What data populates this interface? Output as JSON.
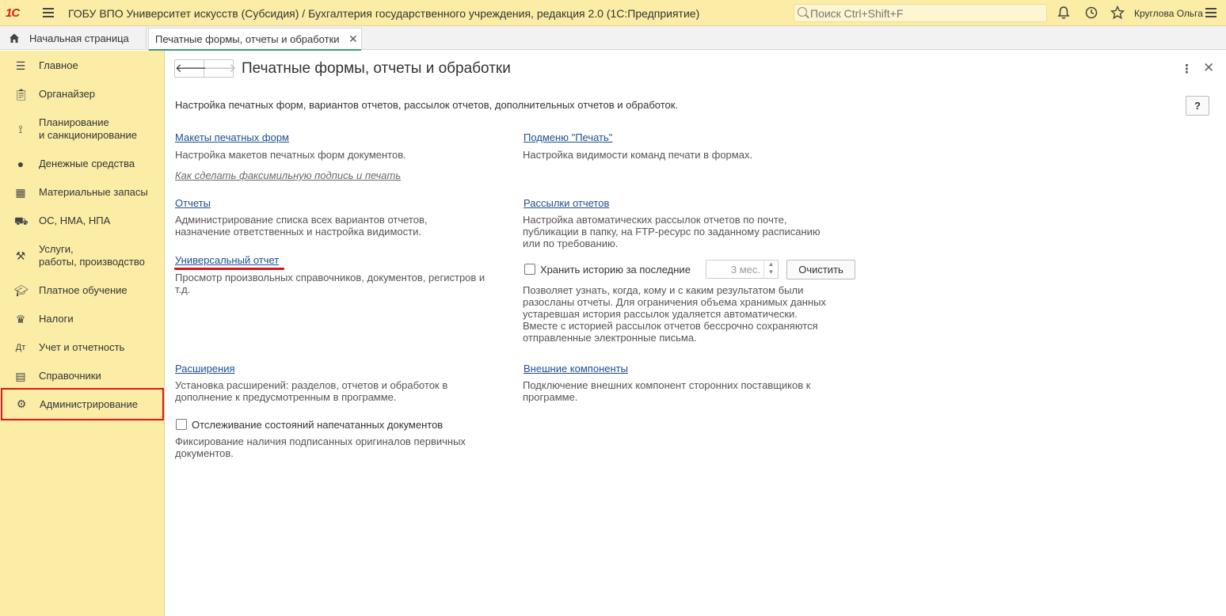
{
  "titlebar": {
    "logo": "1С",
    "title": "ГОБУ ВПО Университет искусств (Субсидия) / Бухгалтерия государственного учреждения, редакция 2.0  (1С:Предприятие)",
    "search_placeholder": "Поиск Ctrl+Shift+F",
    "user": "Круглова Ольга"
  },
  "tabs": {
    "home": "Начальная страница",
    "active": "Печатные формы, отчеты и обработки"
  },
  "sidebar": {
    "items": [
      {
        "label": "Главное",
        "icon": "menu-icon"
      },
      {
        "label": "Органайзер",
        "icon": "clipboard-icon"
      },
      {
        "label": "Планирование\nи санкционирование",
        "icon": "chart-icon"
      },
      {
        "label": "Денежные средства",
        "icon": "coin-icon"
      },
      {
        "label": "Материальные запасы",
        "icon": "blocks-icon"
      },
      {
        "label": "ОС, НМА, НПА",
        "icon": "truck-icon"
      },
      {
        "label": "Услуги,\nработы, производство",
        "icon": "tools-icon"
      },
      {
        "label": "Платное обучение",
        "icon": "graduation-icon"
      },
      {
        "label": "Налоги",
        "icon": "emblem-icon"
      },
      {
        "label": "Учет и отчетность",
        "icon": "accounting-icon"
      },
      {
        "label": "Справочники",
        "icon": "book-icon"
      },
      {
        "label": "Администрирование",
        "icon": "gear-icon"
      }
    ]
  },
  "form": {
    "title": "Печатные формы, отчеты и обработки",
    "intro": "Настройка печатных форм, вариантов отчетов, рассылок отчетов, дополнительных отчетов и обработок.",
    "help": "?",
    "left": {
      "layouts_link": "Макеты печатных форм",
      "layouts_desc": "Настройка макетов печатных форм документов.",
      "facsimile_link": "Как сделать факсимильную подпись и печать",
      "reports_link": "Отчеты",
      "reports_desc": "Администрирование списка всех вариантов отчетов,\nназначение ответственных и настройка видимости.",
      "universal_link": "Универсальный отчет",
      "universal_desc": "Просмотр произвольных справочников, документов, регистров и\nт.д.",
      "extensions_link": "Расширения",
      "extensions_desc": "Установка расширений: разделов, отчетов и обработок в\nдополнение к предусмотренным в программе.",
      "tracking_label": "Отслеживание состояний напечатанных документов",
      "tracking_desc": "Фиксирование наличия подписанных оригиналов первичных\nдокументов."
    },
    "right": {
      "submenu_link": "Подменю \"Печать\"",
      "submenu_desc": "Настройка видимости команд печати в формах.",
      "mailings_link": "Рассылки отчетов",
      "mailings_desc": "Настройка автоматических рассылок отчетов по почте,\nпубликации в папку, на FTP-ресурс по заданному расписанию\nили по требованию.",
      "history_label": "Хранить историю за последние",
      "history_value": "3 мес.",
      "clear_button": "Очистить",
      "history_desc": "Позволяет узнать, когда, кому и с каким результатом были\nразосланы отчеты. Для ограничения объема хранимых данных\nустаревшая история рассылок удаляется автоматически.\nВместе с историей рассылок отчетов бессрочно сохраняются\nотправленные электронные письма.",
      "components_link": "Внешние компоненты",
      "components_desc": "Подключение внешних компонент сторонних поставщиков к\nпрограмме."
    }
  }
}
